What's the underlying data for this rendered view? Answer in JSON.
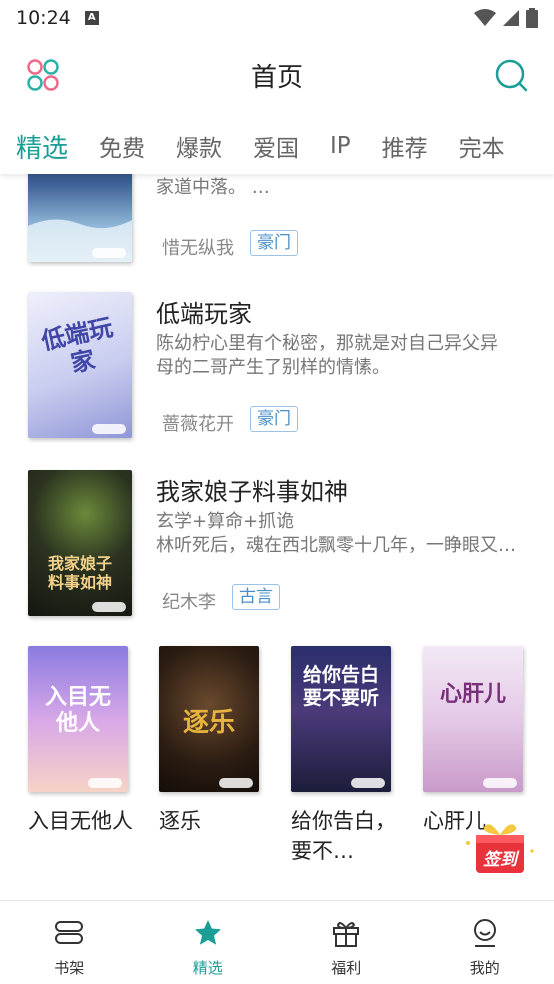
{
  "status_bar": {
    "time": "10:24"
  },
  "header": {
    "title": "首页"
  },
  "tabs": [
    {
      "label": "精选",
      "active": true
    },
    {
      "label": "免费",
      "active": false
    },
    {
      "label": "爆款",
      "active": false
    },
    {
      "label": "爱国",
      "active": false
    },
    {
      "label": "IP",
      "active": false
    },
    {
      "label": "推荐",
      "active": false
    },
    {
      "label": "完本",
      "active": false
    }
  ],
  "books": [
    {
      "title": "",
      "desc": [
        "家道中落。 …"
      ],
      "author": "惜无纵我",
      "tag": "豪门"
    },
    {
      "title": "低端玩家",
      "desc": [
        "陈幼柠心里有个秘密，那就是对自己异父异",
        "母的二哥产生了别样的情愫。"
      ],
      "author": "蔷薇花开",
      "tag": "豪门",
      "cover_text": "低端玩家"
    },
    {
      "title": "我家娘子料事如神",
      "desc": [
        "玄学+算命+抓诡",
        "林听死后，魂在西北飘零十几年，一睁眼又…"
      ],
      "author": "纪木李",
      "tag": "古言",
      "cover_text": "我家娘子料事如神"
    }
  ],
  "grid_books": [
    {
      "title": "入目无他人",
      "cover_text": "入目无他人"
    },
    {
      "title": "逐乐",
      "cover_text": "逐乐"
    },
    {
      "title": "给你告白，要不…",
      "cover_text": "给你告白要不要听"
    },
    {
      "title": "心肝儿",
      "cover_text": "心肝儿"
    }
  ],
  "signin": {
    "label": "签到"
  },
  "bottom_nav": [
    {
      "label": "书架",
      "icon": "bookshelf-icon",
      "active": false
    },
    {
      "label": "精选",
      "icon": "star-icon",
      "active": true
    },
    {
      "label": "福利",
      "icon": "gift-icon",
      "active": false
    },
    {
      "label": "我的",
      "icon": "user-icon",
      "active": false
    }
  ],
  "colors": {
    "accent": "#1a9e96",
    "tag_blue": "#4a90c8"
  }
}
